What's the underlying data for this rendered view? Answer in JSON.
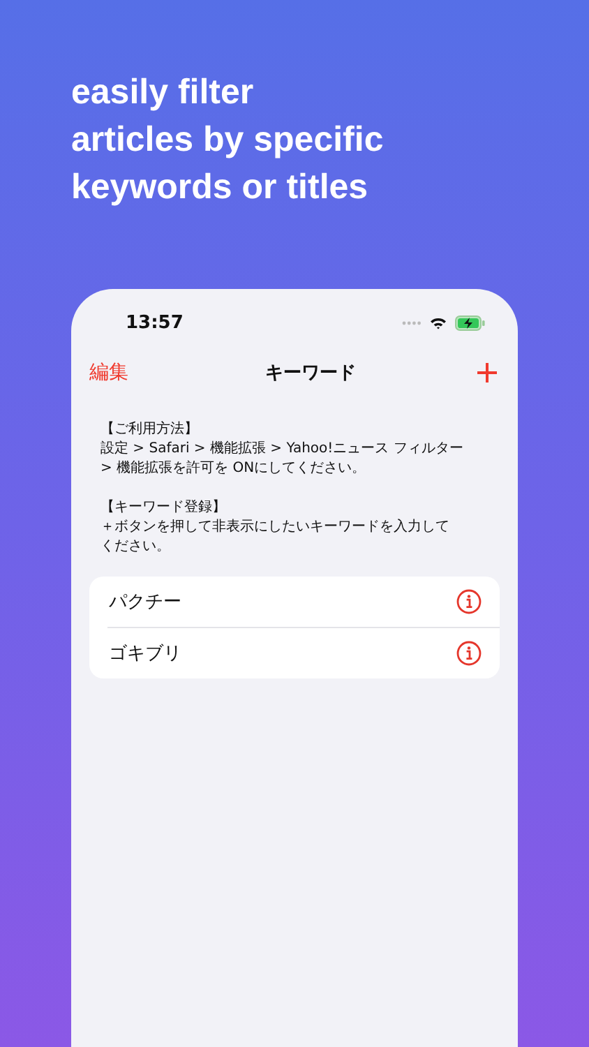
{
  "headline": [
    "easily filter",
    "articles by specific",
    "keywords or titles"
  ],
  "status_bar": {
    "time": "13:57"
  },
  "nav": {
    "edit": "編集",
    "title": "キーワード"
  },
  "instructions": [
    {
      "heading": "【ご利用方法】",
      "body": [
        "設定 > Safari > 機能拡張 > Yahoo!ニュース フィルター",
        "> 機能拡張を許可を ONにしてください。"
      ]
    },
    {
      "heading": "【キーワード登録】",
      "body": [
        "＋ボタンを押して非表示にしたいキーワードを入力して",
        "ください。"
      ]
    }
  ],
  "keywords": [
    {
      "label": "パクチー"
    },
    {
      "label": "ゴキブリ"
    }
  ]
}
